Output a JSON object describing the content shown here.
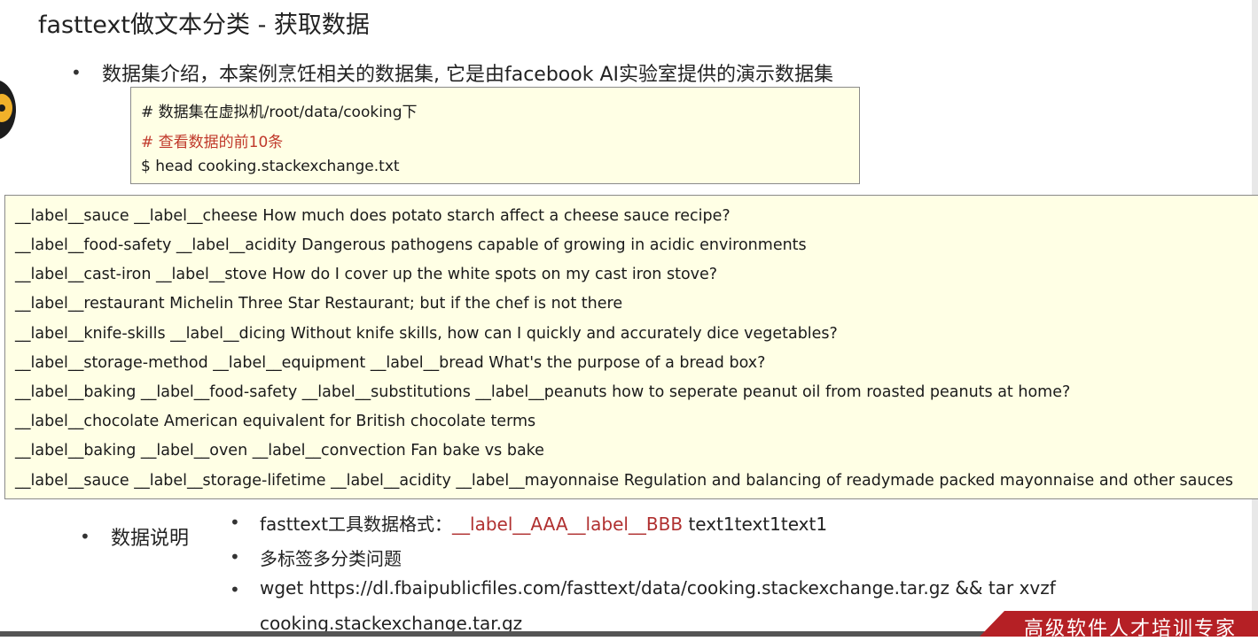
{
  "slide": {
    "title": "fasttext做文本分类 - 获取数据",
    "intro_bullet": "数据集介绍，本案例烹饪相关的数据集, 它是由facebook AI实验室提供的演示数据集"
  },
  "command_box": {
    "lines": [
      "# 数据集在虚拟机/root/data/cooking下",
      "# 查看数据的前10条",
      "$ head cooking.stackexchange.txt"
    ]
  },
  "output_box": {
    "lines": [
      "__label__sauce __label__cheese How much does potato starch affect a cheese sauce recipe?",
      "__label__food-safety __label__acidity Dangerous pathogens capable of growing in acidic environments",
      "__label__cast-iron __label__stove How do I cover up the white spots on my cast iron stove?",
      "__label__restaurant Michelin Three Star Restaurant; but if the chef is not there",
      "__label__knife-skills __label__dicing Without knife skills, how can I quickly and accurately dice vegetables?",
      "__label__storage-method __label__equipment __label__bread What's the purpose of a bread box?",
      "__label__baking __label__food-safety __label__substitutions __label__peanuts how to seperate peanut oil from roasted peanuts at home?",
      "__label__chocolate American equivalent for British chocolate terms",
      "__label__baking __label__oven __label__convection Fan bake vs bake",
      "__label__sauce __label__storage-lifetime __label__acidity __label__mayonnaise Regulation and balancing of readymade packed mayonnaise and other sauces"
    ]
  },
  "explanation": {
    "label": "数据说明",
    "format_prefix": "fasttext工具数据格式：",
    "format_example": "__label__AAA__label__BBB",
    "format_suffix": " text1text1text1",
    "multi_label": "多标签多分类问题",
    "download_line1": "wget https://dl.fbaipublicfiles.com/fasttext/data/cooking.stackexchange.tar.gz && tar xvzf",
    "download_line2": "cooking.stackexchange.tar.gz"
  },
  "footer": {
    "badge_text": "高级软件人才培训专家"
  },
  "colors": {
    "code_bg": "#ffffe5",
    "comment_red": "#c0392b",
    "brand_red": "#b52025"
  },
  "icons": {
    "mascot": "mascot-icon",
    "bullet": "bullet-dot-icon"
  }
}
